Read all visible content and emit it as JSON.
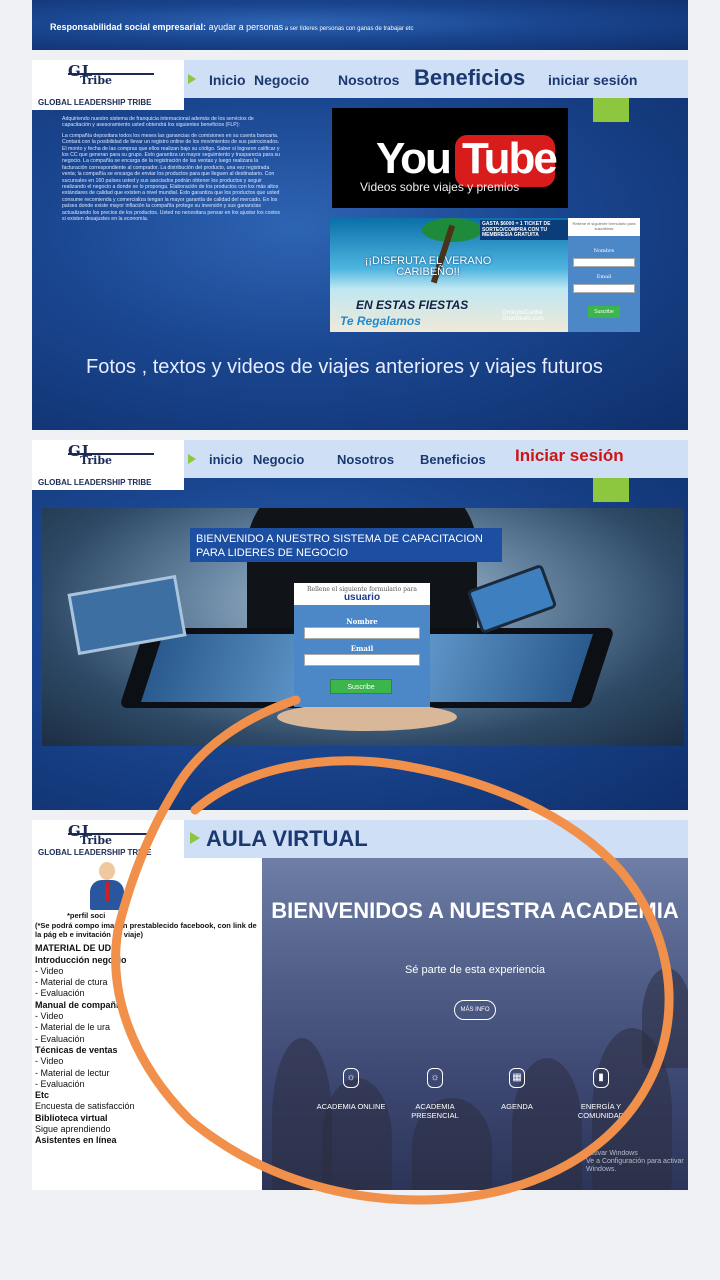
{
  "top_strip": {
    "bold": "Responsabilidad social empresarial:",
    "text": " ayudar a personas",
    "small": " a ser líderes personas con ganas de trabajar etc"
  },
  "logo": {
    "line1": "GL",
    "line2": "Tribe",
    "line3": "GLOBAL LEADERSHIP TRIBE"
  },
  "slide1": {
    "nav": [
      "Inicio",
      "Negocio",
      "Nosotros",
      "Beneficios",
      "iniciar sesión"
    ],
    "body_paragraphs": [
      "Adquiriendo nuestro sistema de franquicia internacional además de los servicios de capacitación y asesoramiento usted obtendrá los siguientes beneficios (FLP):",
      "La compañía depositara todos los meses las ganancias de comisiones en su cuenta bancaria. Contará con la posibilidad de llevar un registro online de los movimientos de sus patrocinados. El monto y fecha de las compras que ellos realizan bajo su código. Saber si lograron calificar y los CC que generan para su grupo. Esto garantiza un mayor seguimiento y trasparecia para su negocio. La compañía se encarga de la registración de las ventas y luego realizara la facturación correspondiente al comprador. La distribución del producto, una vez registrada venta; la compañía se encarga de enviar los productos para que lleguen al destinatario. Con sucursales en 160 países usted y sus asociados podrán obtener los productos y seguir realizando el negocio a donde se lo proponga. Elaboración de los productos con los más altos estándares de calidad que existen a nivel mundial. Esto garantiza que los productos que usted consume recomienda y comercializa tengan la mayor garantía de calidad del mercado. En los países donde existe mayor inflación la compañía protege su inversión y sus ganancias actualizando los precios de los productos. Usted no necesitara pensar en los ajustar los costos si existen desajustes en la economía."
    ],
    "youtube": {
      "you": "You",
      "tube": "Tube",
      "caption": "Videos sobre viajes y premios"
    },
    "promo": {
      "badge": "GASTA $6000 = 1 TICKET DE SORTEO/COMPRA CON TU MEMBRESIA GRATUITA",
      "disfruta": "¡¡DISFRUTA EL VERANO CARIBEÑO!!",
      "fiestas": "EN ESTAS FIESTAS",
      "regalamos": "Te Regalamos",
      "site": "Ocoruto/Caribe GranDeals.com"
    },
    "form": {
      "header": "Rellene el siguiente formulario para suscribirse",
      "name_label": "Nombre",
      "email_label": "Email",
      "button": "Suscribe"
    },
    "fotos_text": "Fotos , textos y videos de viajes anteriores y viajes futuros"
  },
  "slide2": {
    "nav": [
      "inicio",
      "Negocio",
      "Nosotros",
      "Beneficios",
      "Iniciar sesión"
    ],
    "welcome": "BIENVENIDO A NUESTRO SISTEMA DE CAPACITACION PARA LIDERES DE NEGOCIO",
    "form": {
      "header": "Rellene el siguiente formulario para",
      "header_title": "usuario",
      "name_label": "Nombre",
      "email_label": "Email",
      "button": "Suscribe"
    }
  },
  "slide3": {
    "aula_title": "AULA VIRTUAL",
    "perfil": "*perfil soci",
    "note": "(*Se podrá compo imagen prestablecido facebook, con link de la pág eb e invitación de viaje)",
    "outline": [
      {
        "text": "MATERIAL DE UDIO",
        "type": "h"
      },
      {
        "text": "Introducción negocio",
        "type": "h"
      },
      {
        "text": "-   Video",
        "type": "li"
      },
      {
        "text": "-   Material de ctura",
        "type": "li"
      },
      {
        "text": "-   Evaluación",
        "type": "li"
      },
      {
        "text": "Manual de compañía",
        "type": "h"
      },
      {
        "text": "-   Video",
        "type": "li"
      },
      {
        "text": "-   Material de le ura",
        "type": "li"
      },
      {
        "text": "-   Evaluación",
        "type": "li"
      },
      {
        "text": "Técnicas de ventas",
        "type": "h"
      },
      {
        "text": "-   Video",
        "type": "li"
      },
      {
        "text": "-   Material de lectur",
        "type": "li"
      },
      {
        "text": "-   Evaluación",
        "type": "li"
      },
      {
        "text": "Etc",
        "type": "h"
      },
      {
        "text": "Encuesta de satisfacción",
        "type": "li"
      },
      {
        "text": "Biblioteca virtual",
        "type": "h"
      },
      {
        "text": "Sigue aprendiendo",
        "type": "li"
      },
      {
        "text": "Asistentes en línea",
        "type": "h"
      }
    ],
    "academia": {
      "title": "BIENVENIDOS A NUESTRA ACADEMIA",
      "subtitle": "Sé parte de esta experiencia",
      "more_button": "MÁS INFO",
      "features": [
        "ACADEMIA ONLINE",
        "ACADEMIA PRESENCIAL",
        "AGENDA",
        "ENERGÍA Y COMUNIDAD"
      ],
      "windows_1": "Activar Windows",
      "windows_2": "Ve a Configuración para activar Windows."
    }
  },
  "colors": {
    "navy": "#1c3870",
    "accent_green": "#8dc63f",
    "annotation_orange": "#f0904a",
    "signin_red": "#cc1515"
  }
}
